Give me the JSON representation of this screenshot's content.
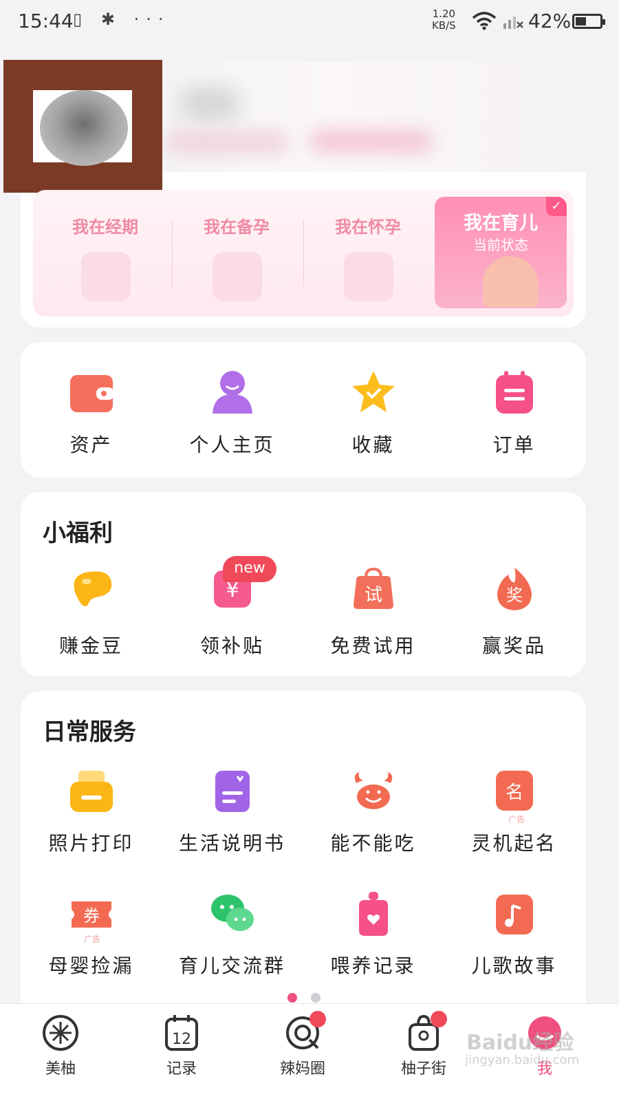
{
  "status_bar": {
    "time": "15:44",
    "left_icons": "▯ ✱ ···",
    "net_speed_value": "1.20",
    "net_speed_unit": "KB/S",
    "battery": "42%"
  },
  "stages": {
    "items": [
      {
        "label": "我在经期"
      },
      {
        "label": "我在备孕"
      },
      {
        "label": "我在怀孕"
      }
    ],
    "active": {
      "label": "我在育儿",
      "sub": "当前状态",
      "check": "✓"
    }
  },
  "quick_actions": [
    {
      "label": "资产",
      "icon": "wallet-icon"
    },
    {
      "label": "个人主页",
      "icon": "person-icon"
    },
    {
      "label": "收藏",
      "icon": "star-icon"
    },
    {
      "label": "订单",
      "icon": "order-icon"
    }
  ],
  "welfare": {
    "title": "小福利",
    "badge": "new",
    "items": [
      {
        "label": "赚金豆",
        "icon": "bean-icon"
      },
      {
        "label": "领补贴",
        "icon": "subsidy-icon",
        "glyph": "¥"
      },
      {
        "label": "免费试用",
        "icon": "trial-bag-icon",
        "glyph": "试"
      },
      {
        "label": "赢奖品",
        "icon": "prize-flame-icon",
        "glyph": "奖"
      }
    ]
  },
  "services": {
    "title": "日常服务",
    "ad_label": "广告",
    "items": [
      {
        "label": "照片打印",
        "icon": "printer-icon"
      },
      {
        "label": "生活说明书",
        "icon": "manual-icon"
      },
      {
        "label": "能不能吃",
        "icon": "crab-icon"
      },
      {
        "label": "灵机起名",
        "icon": "name-icon",
        "glyph": "名"
      },
      {
        "label": "母婴捡漏",
        "icon": "coupon-icon",
        "glyph": "券"
      },
      {
        "label": "育儿交流群",
        "icon": "wechat-icon"
      },
      {
        "label": "喂养记录",
        "icon": "bottle-icon"
      },
      {
        "label": "儿歌故事",
        "icon": "music-icon"
      }
    ]
  },
  "bottom_nav": [
    {
      "label": "美柚",
      "icon": "meiyou-icon"
    },
    {
      "label": "记录",
      "icon": "calendar-icon",
      "day": "12"
    },
    {
      "label": "辣妈圈",
      "icon": "circle-icon"
    },
    {
      "label": "柚子街",
      "icon": "shop-bag-icon"
    },
    {
      "label": "我",
      "icon": "me-icon"
    }
  ],
  "watermark": {
    "main": "Baidu经验",
    "sub": "jingyan.baidu.com"
  },
  "colors": {
    "accent": "#f0507f",
    "badge": "#f04a5a",
    "stage_text": "#f08aa5"
  }
}
